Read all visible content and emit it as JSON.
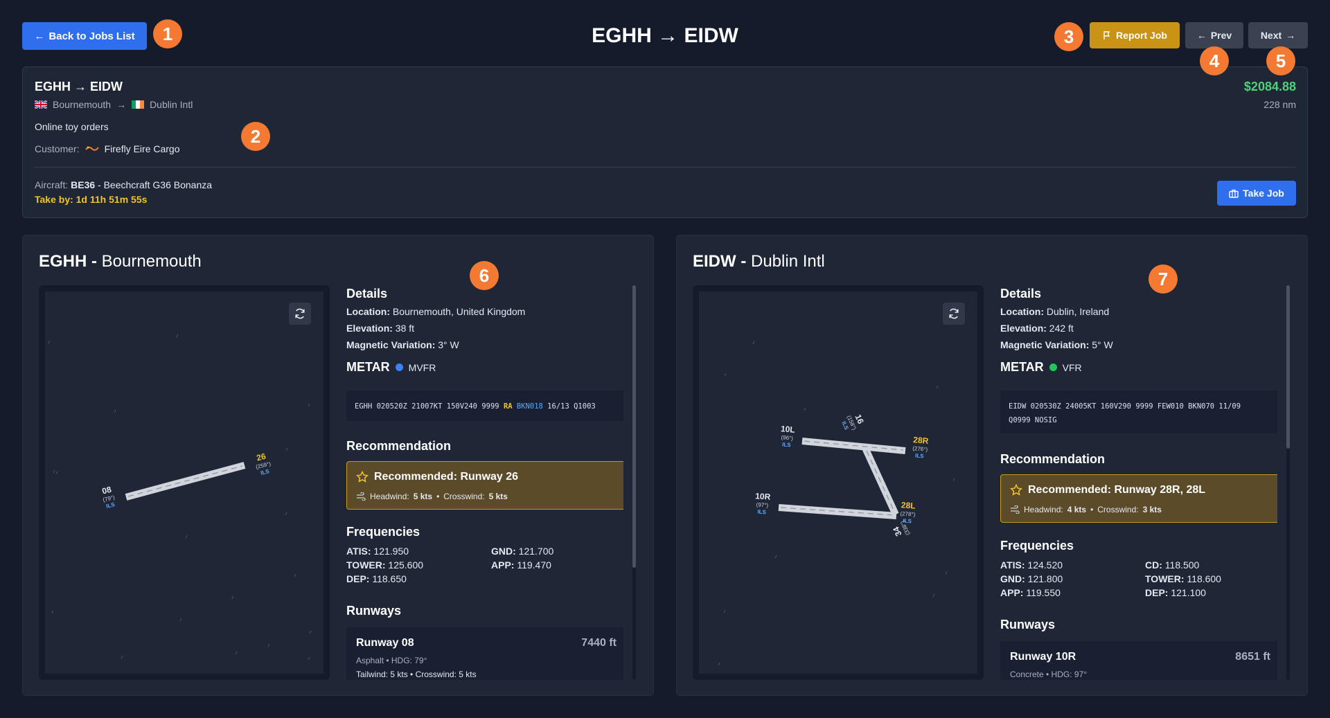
{
  "header": {
    "back_label": "Back to Jobs List",
    "title": "EGHH → EIDW",
    "report_label": "Report Job",
    "prev_label": "Prev",
    "next_label": "Next"
  },
  "badges": [
    "1",
    "2",
    "3",
    "4",
    "5",
    "6",
    "7"
  ],
  "job": {
    "route": "EGHH → EIDW",
    "origin_name": "Bournemouth",
    "arrow": "→",
    "destination_name": "Dublin Intl",
    "description": "Online toy orders",
    "customer_label": "Customer:",
    "customer_name": "Firefly Eire Cargo",
    "price": "$2084.88",
    "distance": "228 nm",
    "aircraft_label": "Aircraft:",
    "aircraft_code": "BE36",
    "aircraft_name": " - Beechcraft G36 Bonanza",
    "take_by": "Take by: 1d 11h 51m 55s",
    "take_job_label": "Take Job"
  },
  "departure": {
    "icao": "EGHH",
    "sep": " - ",
    "name": "Bournemouth",
    "details_title": "Details",
    "location_label": "Location:",
    "location": " Bournemouth, United Kingdom",
    "elevation_label": "Elevation:",
    "elevation": " 38 ft",
    "magvar_label": "Magnetic Variation:",
    "magvar": " 3° W",
    "metar_title": "METAR",
    "flight_category": "MVFR",
    "metar_pre": "EGHH 020520Z 21007KT 150V240 9999 ",
    "metar_ra": "RA",
    "metar_bkn": "BKN018",
    "metar_post": " 16/13 Q1003",
    "recommendation_title": "Recommendation",
    "recommended": "Recommended: Runway 26",
    "headwind_label": "Headwind:",
    "headwind": "5 kts",
    "crosswind_label": "Crosswind:",
    "crosswind": "5 kts",
    "frequencies_title": "Frequencies",
    "frequencies": [
      {
        "label": "ATIS:",
        "value": " 121.950"
      },
      {
        "label": "GND:",
        "value": " 121.700"
      },
      {
        "label": "TOWER:",
        "value": " 125.600"
      },
      {
        "label": "APP:",
        "value": " 119.470"
      },
      {
        "label": "DEP:",
        "value": " 118.650"
      }
    ],
    "runways_title": "Runways",
    "runway": {
      "title": "Runway 08",
      "length": "7440 ft",
      "sub": "Asphalt • HDG: 79°",
      "wind": "Tailwind: 5 kts • Crosswind: 5 kts"
    },
    "map_labels": {
      "r08": "08",
      "r08_hdg": "(79°)",
      "r08_ils": "ILS",
      "r26": "26",
      "r26_hdg": "(259°)",
      "r26_ils": "ILS"
    }
  },
  "arrival": {
    "icao": "EIDW",
    "sep": " - ",
    "name": "Dublin Intl",
    "details_title": "Details",
    "location_label": "Location:",
    "location": " Dublin, Ireland",
    "elevation_label": "Elevation:",
    "elevation": " 242 ft",
    "magvar_label": "Magnetic Variation:",
    "magvar": " 5° W",
    "metar_title": "METAR",
    "flight_category": "VFR",
    "metar_line1": "EIDW 020530Z 24005KT 160V290 9999 FEW010 BKN070 11/09",
    "metar_line2": "Q0999 NOSIG",
    "recommendation_title": "Recommendation",
    "recommended": "Recommended: Runway 28R, 28L",
    "headwind_label": "Headwind:",
    "headwind": "4 kts",
    "crosswind_label": "Crosswind:",
    "crosswind": "3 kts",
    "frequencies_title": "Frequencies",
    "frequencies": [
      {
        "label": "ATIS:",
        "value": " 124.520"
      },
      {
        "label": "CD:",
        "value": " 118.500"
      },
      {
        "label": "GND:",
        "value": " 121.800"
      },
      {
        "label": "TOWER:",
        "value": " 118.600"
      },
      {
        "label": "APP:",
        "value": " 119.550"
      },
      {
        "label": "DEP:",
        "value": " 121.100"
      }
    ],
    "runways_title": "Runways",
    "runway": {
      "title": "Runway 10R",
      "length": "8651 ft",
      "sub": "Concrete • HDG: 97°"
    },
    "map_labels": {
      "r10l": "10L",
      "r10l_hdg": "(96°)",
      "r10l_ils": "ILS",
      "r28r": "28R",
      "r28r_hdg": "(276°)",
      "r28r_ils": "ILS",
      "r16": "16",
      "r16_hdg": "(158°)",
      "r16_ils": "ILS",
      "r10r": "10R",
      "r10r_hdg": "(97°)",
      "r10r_ils": "ILS",
      "r28l": "28L",
      "r28l_hdg": "(278°)",
      "r28l_ils": "ILS",
      "r34": "34",
      "r34_hdg": "(338°)"
    }
  },
  "colors": {
    "mvfr": "#3b82f6",
    "vfr": "#22c55e",
    "accent": "#2f6fed",
    "warning": "#c99315"
  }
}
